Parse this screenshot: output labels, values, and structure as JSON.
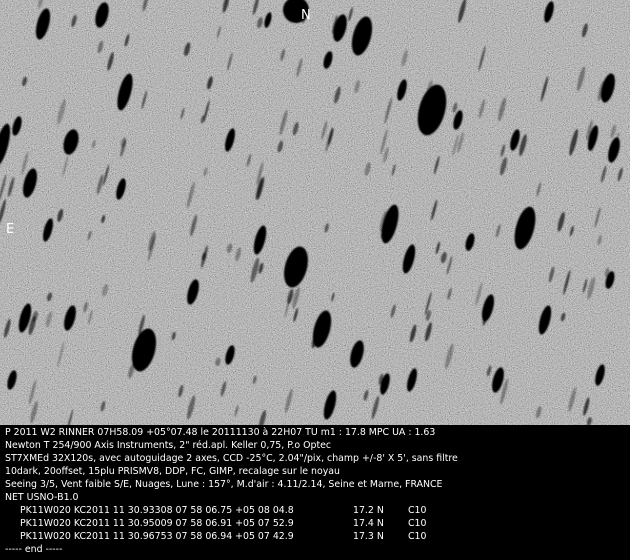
{
  "image": {
    "directions": {
      "north": "N",
      "east": "E"
    },
    "colors": {
      "sky": "#8a8a8a",
      "stars": "#050505",
      "caption_bg": "#000000",
      "caption_text": "#ffffff"
    }
  },
  "caption": {
    "lines": [
      "P 2011 W2 RINNER 07H58.09 +05°07.48 le 20111130 à 22H07 TU m1 : 17.8 MPC UA : 1.63",
      "Newton T 254/900 Axis Instruments, 2\" réd.apl. Keller 0,75, P.o Optec",
      "ST7XMEd 32X120s, avec autoguidage 2 axes, CCD -25°C, 2.04\"/pix, champ +/-8' X 5', sans filtre",
      "10dark, 20offset, 15plu PRISMV8, DDP, FC, GIMP, recalage sur le noyau",
      "Seeing 3/5, Vent faible S/E, Nuages, Lune : 157°, M.d'air : 4.11/2.14, Seine et Marne, FRANCE",
      "NET USNO-B1.0"
    ],
    "observations": [
      {
        "id": "PK11W020 KC2011 11 30.93308 07 58 06.75 +05 08 04.8",
        "mag": "17.2 N",
        "code": "C10"
      },
      {
        "id": "PK11W020 KC2011 11 30.95009 07 58 06.91 +05 07 52.9",
        "mag": "17.4 N",
        "code": "C10"
      },
      {
        "id": "PK11W020 KC2011 11 30.96753 07 58 06.94 +05 07 42.9",
        "mag": "17.3 N",
        "code": "C10"
      }
    ],
    "end_marker": "----- end -----"
  }
}
